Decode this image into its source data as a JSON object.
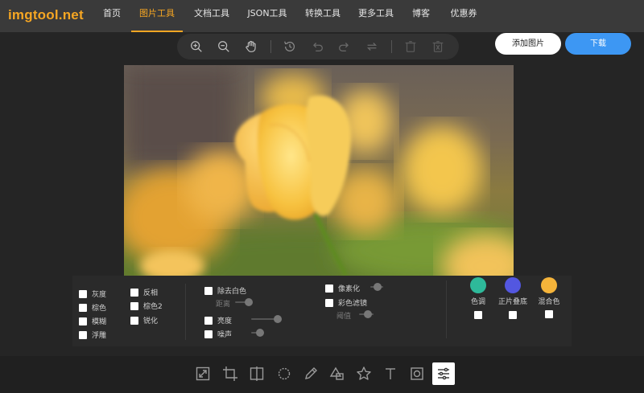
{
  "header": {
    "logo": "imgtool.net",
    "nav": [
      {
        "label": "首页",
        "active": false
      },
      {
        "label": "图片工具",
        "active": true
      },
      {
        "label": "文档工具",
        "active": false
      },
      {
        "label": "JSON工具",
        "active": false
      },
      {
        "label": "转换工具",
        "active": false
      },
      {
        "label": "更多工具",
        "active": false
      },
      {
        "label": "博客",
        "active": false
      },
      {
        "label": "优惠券",
        "active": false
      }
    ]
  },
  "actions": {
    "add_image": "添加图片",
    "download": "下载"
  },
  "top_toolbar": {
    "icons": [
      "zoom-in-icon",
      "zoom-out-icon",
      "hand-icon",
      "history-icon",
      "undo-icon",
      "redo-icon",
      "reset-icon",
      "delete-icon",
      "delete-all-icon"
    ]
  },
  "filters": {
    "col1": [
      "灰度",
      "棕色",
      "模糊",
      "浮雕"
    ],
    "col2": [
      "反相",
      "棕色2",
      "锐化"
    ],
    "remove_white": "除去白色",
    "distance": "距离",
    "brightness": "亮度",
    "noise": "噪声",
    "pixelate": "像素化",
    "color_filter": "彩色滤镜",
    "threshold": "阈值",
    "tint": {
      "label": "色调",
      "color": "#2eb99a"
    },
    "multiply": {
      "label": "正片叠底",
      "color": "#5357e0"
    },
    "blend": {
      "label": "混合色",
      "color": "#f5b43a"
    }
  },
  "bottom_toolbar": {
    "icons": [
      "resize-icon",
      "crop-icon",
      "flip-icon",
      "rotate-icon",
      "draw-icon",
      "shape-icon",
      "icon-icon",
      "text-icon",
      "mask-icon",
      "filter-icon"
    ],
    "active": "filter-icon"
  }
}
